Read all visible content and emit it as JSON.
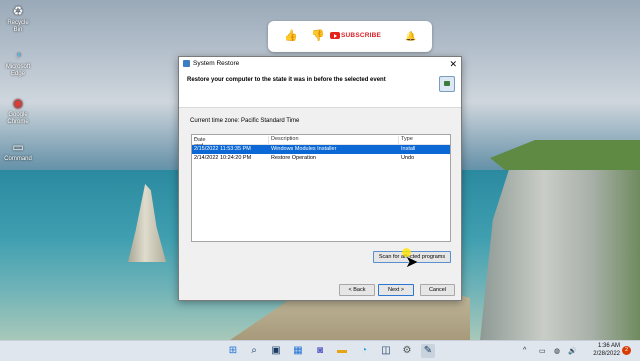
{
  "desktop": {
    "icons": [
      {
        "label": "Recycle Bin",
        "glyph": "♻",
        "icon": "recycle-bin-icon"
      },
      {
        "label": "Microsoft Edge",
        "glyph": "◔",
        "icon": "edge-icon"
      },
      {
        "label": "Google Chrome",
        "glyph": "◉",
        "icon": "chrome-icon"
      },
      {
        "label": "Command",
        "glyph": "▭",
        "icon": "command-icon"
      }
    ]
  },
  "youtube": {
    "like_glyph": "👍",
    "dislike_glyph": "👎",
    "subscribe_label": "SUBSCRIBE",
    "bell_glyph": "🔔"
  },
  "dialog": {
    "title": "System Restore",
    "close_glyph": "✕",
    "header_text": "Restore your computer to the state it was in before the selected event",
    "timezone_text": "Current time zone: Pacific Standard Time",
    "columns": [
      "Date and Time",
      "Description",
      "Type"
    ],
    "rows": [
      {
        "date": "2/15/2022 11:53:35 PM",
        "description": "Windows Modules Installer",
        "type": "Install",
        "selected": true
      },
      {
        "date": "2/14/2022 10:24:20 PM",
        "description": "Restore Operation",
        "type": "Undo",
        "selected": false
      }
    ],
    "scan_label": "Scan for affected programs",
    "back_label": "< Back",
    "next_label": "Next >",
    "cancel_label": "Cancel"
  },
  "taskbar": {
    "items": [
      "start-icon",
      "search-icon",
      "task-view-icon",
      "widgets-icon",
      "chat-icon",
      "file-explorer-icon",
      "edge-icon",
      "store-icon",
      "settings-icon",
      "system-restore-icon"
    ],
    "glyphs": [
      "⊞",
      "⌕",
      "▣",
      "▦",
      "◙",
      "▬",
      "◔",
      "◫",
      "⚙",
      "✎"
    ],
    "tray_chevron": "^",
    "tray_icons": [
      "▭",
      "◍",
      "🔊"
    ],
    "time": "1:36 AM",
    "date": "2/28/2022",
    "notification_count": "2"
  },
  "colors": {
    "selection": "#0c68d4",
    "subscribe": "#d81f26"
  }
}
